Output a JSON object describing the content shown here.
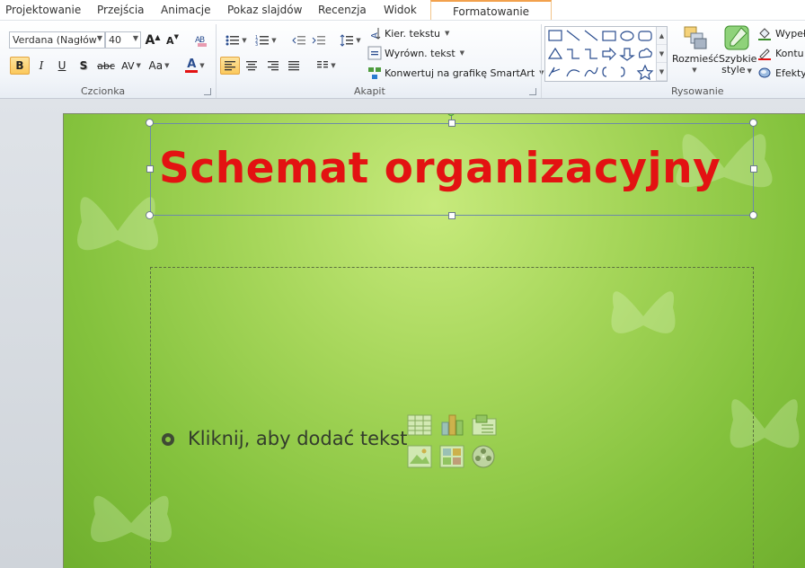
{
  "tabs": [
    {
      "label": "Projektowanie",
      "active": false
    },
    {
      "label": "Przejścia",
      "active": false
    },
    {
      "label": "Animacje",
      "active": false
    },
    {
      "label": "Pokaz slajdów",
      "active": false
    },
    {
      "label": "Recenzja",
      "active": false
    },
    {
      "label": "Widok",
      "active": false
    },
    {
      "label": "Formatowanie",
      "active": true
    }
  ],
  "font_group": {
    "label": "Czcionka",
    "font_name": "Verdana (Nagłów",
    "font_size": "40",
    "grow_label": "A",
    "shrink_label": "A",
    "bold": "B",
    "italic": "I",
    "underline": "U",
    "shadow": "S",
    "strike": "abc",
    "spacing": "AV",
    "case": "Aa",
    "color_label": "A",
    "font_color": "#e31212"
  },
  "paragraph_group": {
    "label": "Akapit",
    "text_direction": "Kier. tekstu",
    "align_text": "Wyrówn. tekst",
    "smartart": "Konwertuj na grafikę SmartArt"
  },
  "drawing_group": {
    "label": "Rysowanie",
    "arrange": "Rozmieść",
    "quick_styles_line1": "Szybkie",
    "quick_styles_line2": "style",
    "fill": "Wypeł",
    "outline": "Kontu",
    "effects": "Efekty"
  },
  "slide": {
    "title": "Schemat organizacyjny",
    "placeholder": "Kliknij, aby dodać tekst"
  },
  "colors": {
    "title_red": "#e31212",
    "active_tab_border": "#f2a14d",
    "slide_green": "#a6d65a"
  }
}
